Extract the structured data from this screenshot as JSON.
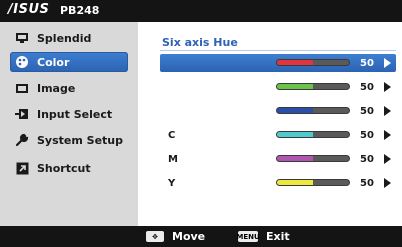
{
  "header": {
    "brand": "/ISUS",
    "model": "PB248"
  },
  "sidebar": {
    "items": [
      {
        "label": "Splendid",
        "icon": "splendid-icon",
        "active": false
      },
      {
        "label": "Color",
        "icon": "palette-icon",
        "active": true
      },
      {
        "label": "Image",
        "icon": "image-icon",
        "active": false
      },
      {
        "label": "Input Select",
        "icon": "input-select-icon",
        "active": false
      },
      {
        "label": "System Setup",
        "icon": "wrench-icon",
        "active": false
      },
      {
        "label": "Shortcut",
        "icon": "shortcut-icon",
        "active": false
      }
    ]
  },
  "main": {
    "title": "Six axis Hue",
    "rows": [
      {
        "label": "",
        "value": "50",
        "level": 0.5,
        "color": "#e0353f",
        "selected": true
      },
      {
        "label": "",
        "value": "50",
        "level": 0.5,
        "color": "#6cc24a",
        "selected": false
      },
      {
        "label": "",
        "value": "50",
        "level": 0.5,
        "color": "#2a4fa8",
        "selected": false
      },
      {
        "label": "C",
        "value": "50",
        "level": 0.5,
        "color": "#4fcbd0",
        "selected": false
      },
      {
        "label": "M",
        "value": "50",
        "level": 0.5,
        "color": "#b055b0",
        "selected": false
      },
      {
        "label": "Y",
        "value": "50",
        "level": 0.5,
        "color": "#ece840",
        "selected": false
      }
    ]
  },
  "footer": {
    "move_label": "Move",
    "exit_label": "Exit",
    "menu_key_label": "MENU"
  },
  "colors": {
    "accent": "#2d62b2",
    "title_text": "#2f62b5",
    "sidebar_bg": "#d9d9d9",
    "bar_track": "#5a5a5a"
  }
}
